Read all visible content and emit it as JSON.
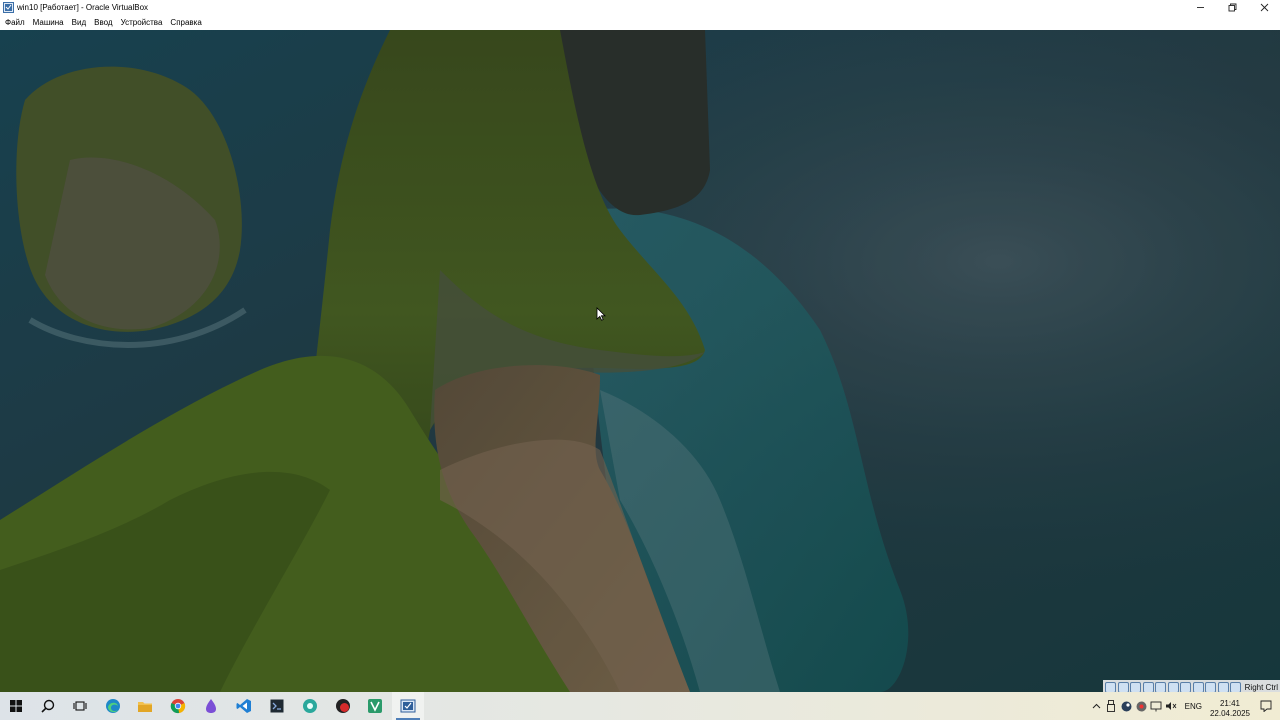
{
  "window": {
    "title": "win10 [Работает] - Oracle VirtualBox",
    "controls": [
      "minimize",
      "restore",
      "close"
    ]
  },
  "menu": [
    "Файл",
    "Машина",
    "Вид",
    "Ввод",
    "Устройства",
    "Справка"
  ],
  "taskbar": {
    "apps": [
      {
        "name": "start",
        "icon": "windows-logo-icon"
      },
      {
        "name": "search",
        "icon": "search-icon"
      },
      {
        "name": "task-view",
        "icon": "task-view-icon"
      },
      {
        "name": "edge",
        "icon": "edge-icon"
      },
      {
        "name": "file-explorer",
        "icon": "folder-icon"
      },
      {
        "name": "chrome",
        "icon": "chrome-icon"
      },
      {
        "name": "app-purple",
        "icon": "purple-app-icon"
      },
      {
        "name": "vscode",
        "icon": "vscode-icon"
      },
      {
        "name": "app-terminal",
        "icon": "terminal-icon"
      },
      {
        "name": "app-teal",
        "icon": "teal-app-icon"
      },
      {
        "name": "app-red",
        "icon": "red-app-icon"
      },
      {
        "name": "app-green",
        "icon": "green-app-icon"
      },
      {
        "name": "virtualbox",
        "icon": "virtualbox-icon",
        "active": true
      }
    ],
    "language": "ENG",
    "time": "21:41",
    "date": "22.04.2025"
  },
  "status_bar": {
    "host_key": "Right Ctrl"
  },
  "colors": {
    "sea_dark": "#173a48",
    "sea_teal": "#1f5a63",
    "cliff_green": "#4b5f22",
    "sand": "#6f6047",
    "taskbar_active": "#4f7fb8"
  }
}
